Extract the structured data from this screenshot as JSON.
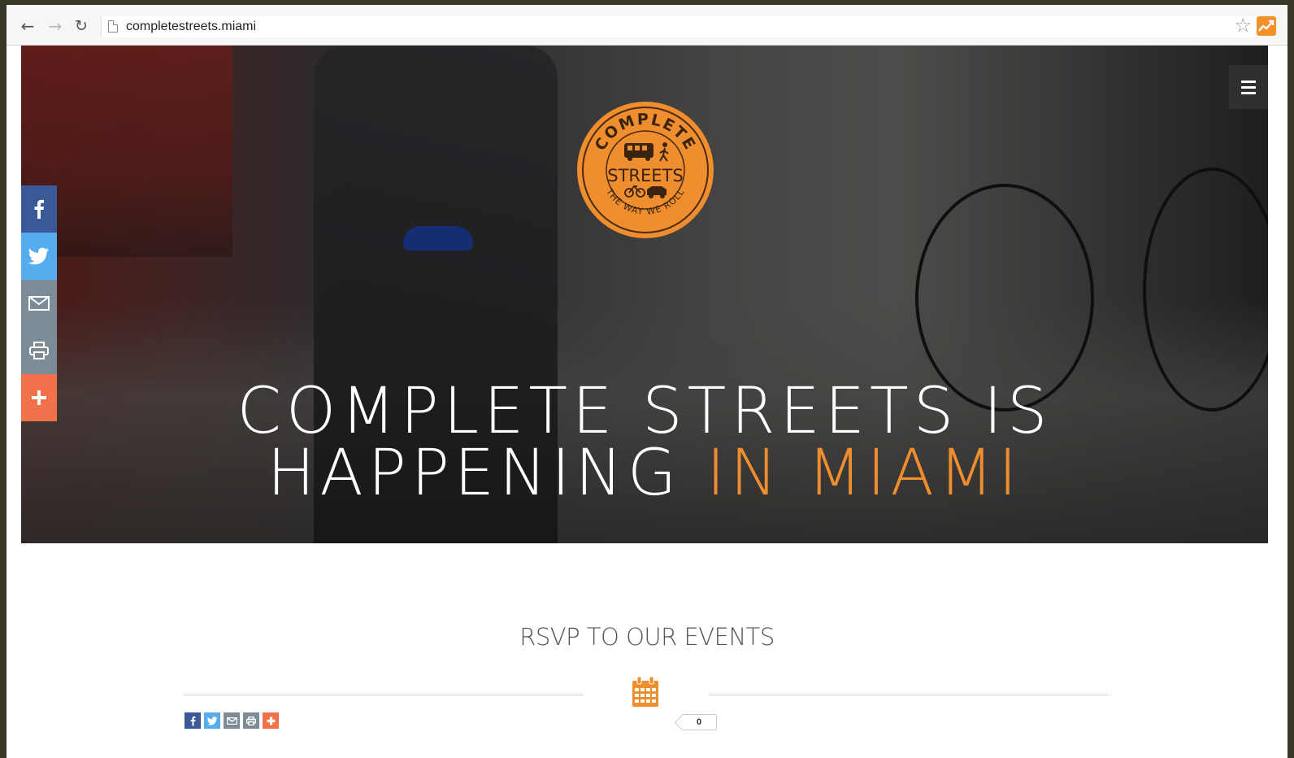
{
  "browser": {
    "url": "completestreets.miami",
    "back_icon": "arrow-left-icon",
    "forward_icon": "arrow-right-icon",
    "reload_icon": "reload-icon",
    "bookmark_icon": "star-icon",
    "extension_icon": "chart-extension-icon"
  },
  "hero": {
    "headline_line1": "COMPLETE STREETS IS",
    "headline_line2_white": "HAPPENING ",
    "headline_line2_accent": "IN MIAMI",
    "menu_icon": "hamburger-menu-icon"
  },
  "logo": {
    "top_text": "COMPLETE",
    "middle_text": "STREETS",
    "bottom_text": "THE WAY WE ROLL"
  },
  "share_rail": [
    "facebook",
    "twitter",
    "email",
    "print",
    "more"
  ],
  "events": {
    "title": "RSVP TO OUR EVENTS",
    "icon": "calendar-icon",
    "share_count": "0"
  },
  "colors": {
    "accent_orange": "#ef8e2f",
    "facebook": "#3b5998",
    "twitter": "#55acee",
    "email_print": "#7d8b97",
    "more": "#f1724a"
  }
}
